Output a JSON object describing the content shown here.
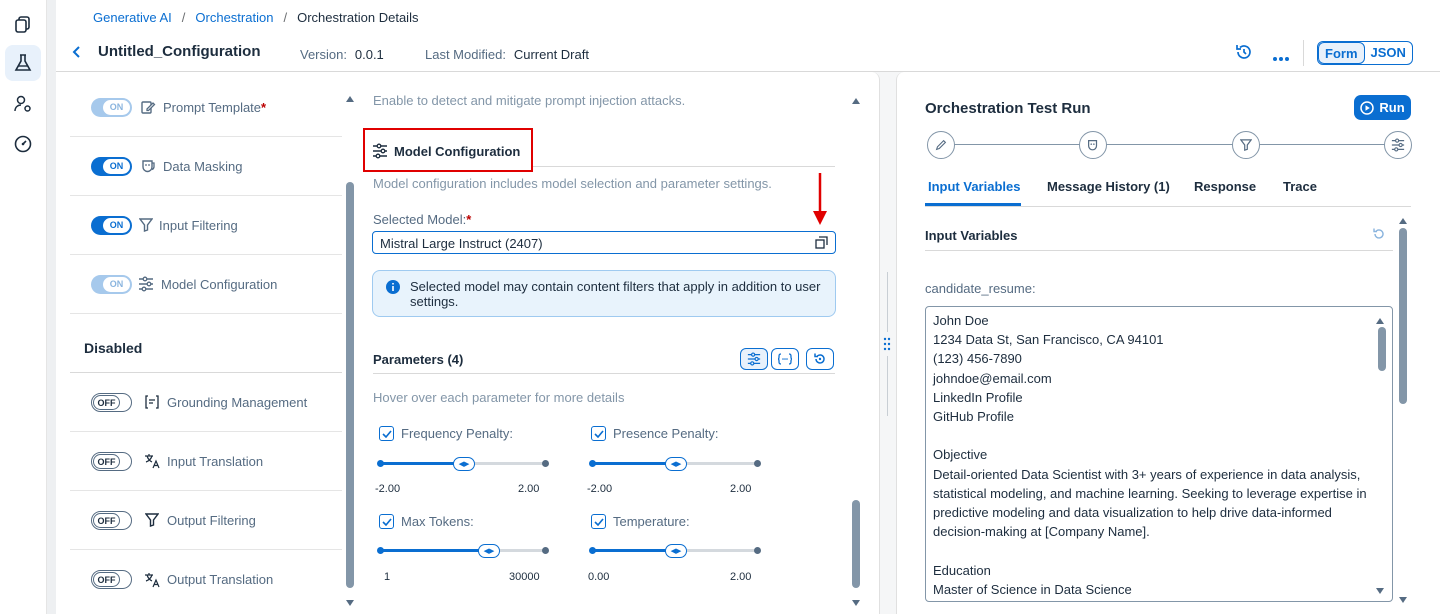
{
  "breadcrumb": {
    "items": [
      "Generative AI",
      "Orchestration",
      "Orchestration Details"
    ]
  },
  "header": {
    "title": "Untitled_Configuration",
    "version_label": "Version:",
    "version_value": "0.0.1",
    "modified_label": "Last Modified:",
    "modified_value": "Current Draft",
    "form_label": "Form",
    "json_label": "JSON"
  },
  "modules": {
    "enabled": [
      {
        "toggle": "ON",
        "label": "Prompt Template",
        "required": "*",
        "icon": "pencil-doc-icon"
      },
      {
        "toggle": "ON",
        "label": "Data Masking",
        "icon": "mask-icon"
      },
      {
        "toggle": "ON",
        "label": "Input Filtering",
        "icon": "filter-icon"
      },
      {
        "toggle": "ON",
        "label": "Model Configuration",
        "icon": "sliders-icon"
      }
    ],
    "disabled_heading": "Disabled",
    "disabled": [
      {
        "toggle": "OFF",
        "label": "Grounding Management",
        "icon": "grounding-icon"
      },
      {
        "toggle": "OFF",
        "label": "Input Translation",
        "icon": "translate-icon"
      },
      {
        "toggle": "OFF",
        "label": "Output Filtering",
        "icon": "filter-icon"
      },
      {
        "toggle": "OFF",
        "label": "Output Translation",
        "icon": "translate-icon"
      }
    ]
  },
  "config": {
    "top_text": "Enable to detect and mitigate prompt injection attacks.",
    "section_title": "Model Configuration",
    "section_desc": "Model configuration includes model selection and parameter settings.",
    "model_label": "Selected Model:",
    "model_required": "*",
    "model_value": "Mistral Large Instruct (2407)",
    "info_text": "Selected model may contain content filters that apply in addition to user settings.",
    "params_title": "Parameters (4)",
    "params_hint": "Hover over each parameter for more details",
    "params": [
      {
        "label": "Frequency Penalty:",
        "min": "-2.00",
        "max": "2.00",
        "value_fraction": 0.5
      },
      {
        "label": "Presence Penalty:",
        "min": "-2.00",
        "max": "2.00",
        "value_fraction": 0.5
      },
      {
        "label": "Max Tokens:",
        "min": "1",
        "max": "30000",
        "value_fraction": 0.66
      },
      {
        "label": "Temperature:",
        "min": "0.00",
        "max": "2.00",
        "value_fraction": 0.5
      }
    ]
  },
  "test_run": {
    "title": "Orchestration Test Run",
    "run_label": "Run",
    "tabs": [
      "Input Variables",
      "Message History (1)",
      "Response",
      "Trace"
    ],
    "section_title": "Input Variables",
    "variable_label": "candidate_resume:",
    "resume_lines": [
      "John Doe",
      "1234 Data St, San Francisco, CA 94101",
      "(123) 456-7890",
      "johndoe@email.com",
      "LinkedIn Profile",
      "GitHub Profile",
      "",
      "Objective",
      "Detail-oriented Data Scientist with 3+ years of experience in data analysis,",
      "statistical modeling, and machine learning. Seeking to leverage expertise in",
      "predictive modeling and data visualization to help drive data-informed",
      "decision-making at [Company Name].",
      "",
      "Education",
      "Master of Science in Data Science"
    ]
  },
  "colors": {
    "accent": "#0a6ed1",
    "highlight_box": "#e00000",
    "annotation_arrow": "#e00000"
  }
}
